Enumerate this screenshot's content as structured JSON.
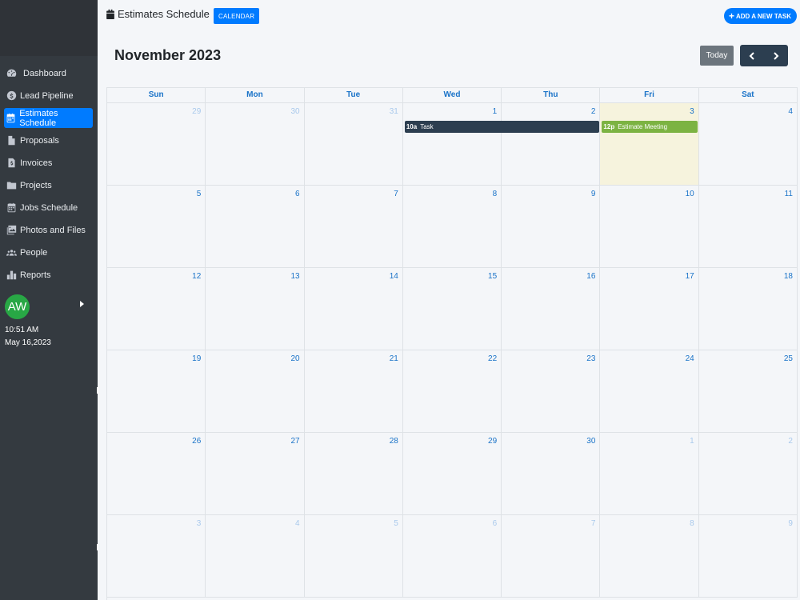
{
  "sidebar": {
    "items": [
      {
        "label": "Dashboard",
        "icon": "dashboard-icon",
        "active": false
      },
      {
        "label": "Lead Pipeline",
        "icon": "dollar-icon",
        "active": false
      },
      {
        "label": "Estimates Schedule",
        "icon": "calendar-icon",
        "active": true
      },
      {
        "label": "Proposals",
        "icon": "file-icon",
        "active": false
      },
      {
        "label": "Invoices",
        "icon": "invoice-icon",
        "active": false
      },
      {
        "label": "Projects",
        "icon": "folder-icon",
        "active": false
      },
      {
        "label": "Jobs Schedule",
        "icon": "calendar-icon",
        "active": false
      },
      {
        "label": "Photos and Files",
        "icon": "images-icon",
        "active": false
      },
      {
        "label": "People",
        "icon": "people-icon",
        "active": false
      },
      {
        "label": "Reports",
        "icon": "bar-chart-icon",
        "active": false
      }
    ],
    "user": {
      "initials": "AW",
      "time": "10:51 AM",
      "date": "May 16,2023"
    }
  },
  "header": {
    "title": "Estimates Schedule",
    "calendar_button": "CALENDAR",
    "add_task_button": "ADD A NEW TASK"
  },
  "calendar": {
    "month_title": "November 2023",
    "today_button": "Today",
    "weekdays": [
      "Sun",
      "Mon",
      "Tue",
      "Wed",
      "Thu",
      "Fri",
      "Sat"
    ],
    "weeks": [
      [
        {
          "n": "29",
          "other": true
        },
        {
          "n": "30",
          "other": true
        },
        {
          "n": "31",
          "other": true
        },
        {
          "n": "1"
        },
        {
          "n": "2"
        },
        {
          "n": "3",
          "today": true
        },
        {
          "n": "4"
        }
      ],
      [
        {
          "n": "5"
        },
        {
          "n": "6"
        },
        {
          "n": "7"
        },
        {
          "n": "8"
        },
        {
          "n": "9"
        },
        {
          "n": "10"
        },
        {
          "n": "11"
        }
      ],
      [
        {
          "n": "12"
        },
        {
          "n": "13"
        },
        {
          "n": "14"
        },
        {
          "n": "15"
        },
        {
          "n": "16"
        },
        {
          "n": "17"
        },
        {
          "n": "18"
        }
      ],
      [
        {
          "n": "19"
        },
        {
          "n": "20"
        },
        {
          "n": "21"
        },
        {
          "n": "22"
        },
        {
          "n": "23"
        },
        {
          "n": "24"
        },
        {
          "n": "25"
        }
      ],
      [
        {
          "n": "26"
        },
        {
          "n": "27"
        },
        {
          "n": "28"
        },
        {
          "n": "29"
        },
        {
          "n": "30"
        },
        {
          "n": "1",
          "other": true
        },
        {
          "n": "2",
          "other": true
        }
      ],
      [
        {
          "n": "3",
          "other": true
        },
        {
          "n": "4",
          "other": true
        },
        {
          "n": "5",
          "other": true
        },
        {
          "n": "6",
          "other": true
        },
        {
          "n": "7",
          "other": true
        },
        {
          "n": "8",
          "other": true
        },
        {
          "n": "9",
          "other": true
        }
      ]
    ],
    "events": [
      {
        "time": "10a",
        "title": "Task",
        "color": "#2c3e50"
      },
      {
        "time": "12p",
        "title": "Estimate Meeting",
        "color": "#7cb342"
      }
    ]
  }
}
